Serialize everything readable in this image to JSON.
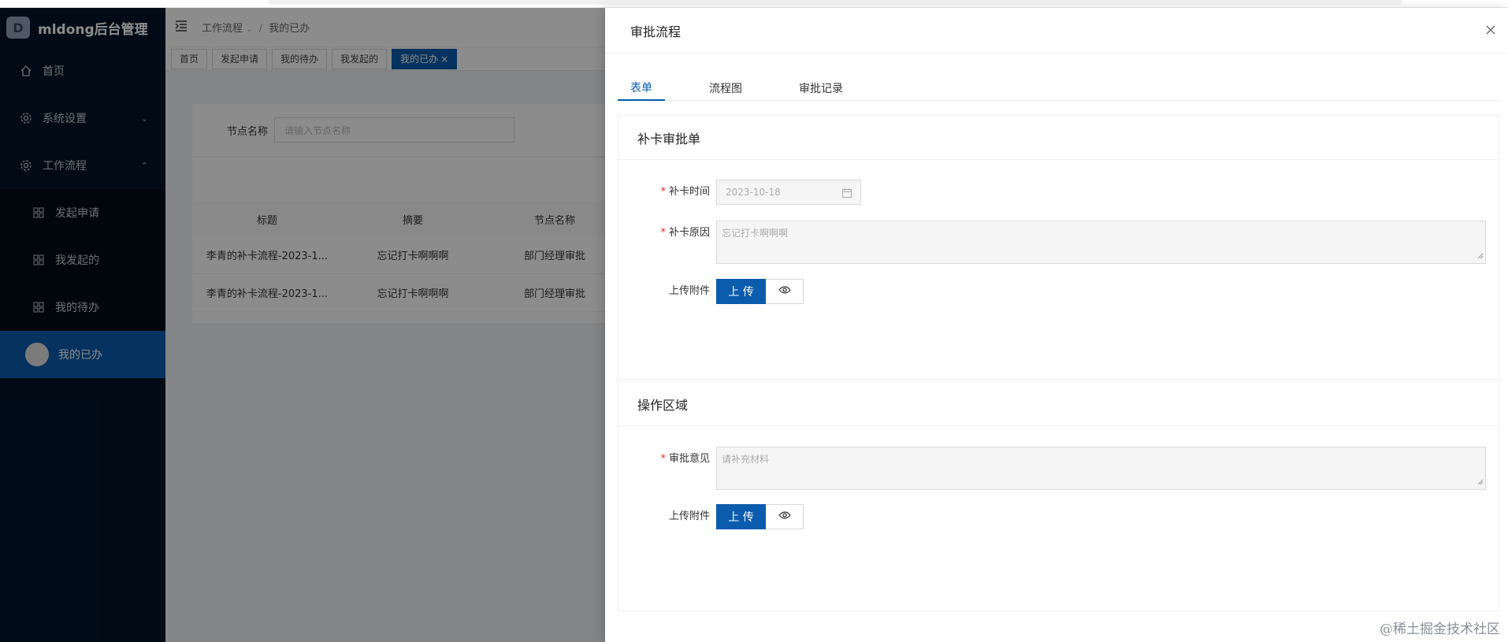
{
  "app": {
    "logo_letter": "D",
    "title": "mldong后台管理"
  },
  "sidebar": {
    "items": [
      {
        "label": "首页"
      },
      {
        "label": "系统设置"
      },
      {
        "label": "工作流程"
      }
    ],
    "subitems": [
      {
        "label": "发起申请"
      },
      {
        "label": "我发起的"
      },
      {
        "label": "我的待办"
      },
      {
        "label": "我的已办"
      }
    ]
  },
  "header": {
    "crumb_parent": "工作流程",
    "crumb_sep": "/",
    "crumb_current": "我的已办"
  },
  "tabs": [
    {
      "label": "首页"
    },
    {
      "label": "发起申请"
    },
    {
      "label": "我的待办"
    },
    {
      "label": "我发起的"
    },
    {
      "label": "我的已办",
      "close": "×"
    }
  ],
  "search": {
    "label": "节点名称",
    "placeholder": "请输入节点名称"
  },
  "table": {
    "columns": [
      "标题",
      "摘要",
      "节点名称"
    ],
    "rows": [
      [
        "李青的补卡流程-2023-1...",
        "忘记打卡啊啊啊",
        "部门经理审批"
      ],
      [
        "李青的补卡流程-2023-1...",
        "忘记打卡啊啊啊",
        "部门经理审批"
      ]
    ]
  },
  "drawer": {
    "title": "审批流程",
    "tabs": [
      "表单",
      "流程图",
      "审批记录"
    ],
    "form_card": {
      "title": "补卡审批单",
      "time_label": "补卡时间",
      "time_value": "2023-10-18",
      "reason_label": "补卡原因",
      "reason_value": "忘记打卡啊啊啊",
      "attach_label": "上传附件",
      "upload_label": "上 传"
    },
    "op_card": {
      "title": "操作区域",
      "opinion_label": "审批意见",
      "opinion_placeholder": "请补充材料",
      "attach_label": "上传附件",
      "upload_label": "上 传"
    }
  },
  "watermark": "@稀土掘金技术社区",
  "colors": {
    "sidebar": "#001529",
    "accent": "#0b5cad",
    "required": "#f5222d"
  }
}
